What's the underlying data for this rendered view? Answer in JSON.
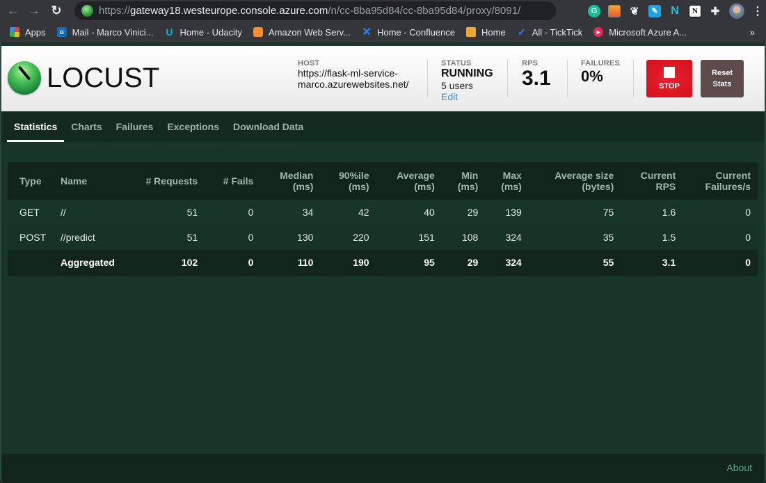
{
  "browser": {
    "url": {
      "scheme": "https://",
      "host": "gateway18.westeurope.console.azure.com",
      "path": "/n/cc-8ba95d84/cc-8ba95d84/proxy/8091/"
    },
    "extensions": [
      "grammarly-icon",
      "image-icon",
      "gnome-icon",
      "pen-icon",
      "nimbus-icon",
      "notion-icon",
      "puzzle-icon"
    ],
    "bookmarks": [
      {
        "label": "Apps",
        "icon": "apps-icon"
      },
      {
        "label": "Mail - Marco Vinici...",
        "icon": "outlook-icon"
      },
      {
        "label": "Home - Udacity",
        "icon": "udacity-icon"
      },
      {
        "label": "Amazon Web Serv...",
        "icon": "aws-icon"
      },
      {
        "label": "Home - Confluence",
        "icon": "confluence-icon"
      },
      {
        "label": "Home",
        "icon": "box-icon"
      },
      {
        "label": "All - TickTick",
        "icon": "ticktick-icon"
      },
      {
        "label": "Microsoft Azure A...",
        "icon": "azure-icon"
      }
    ],
    "bookmarks_more": "»"
  },
  "header": {
    "logo_text": "LOCUST",
    "host_label": "HOST",
    "host_value": "https://flask-ml-service-marco.azurewebsites.net/",
    "status_label": "STATUS",
    "status_value": "RUNNING",
    "users_value": "5 users",
    "edit_label": "Edit",
    "rps_label": "RPS",
    "rps_value": "3.1",
    "failures_label": "FAILURES",
    "failures_value": "0%",
    "stop_label": "STOP",
    "reset_label_1": "Reset",
    "reset_label_2": "Stats"
  },
  "tabs": [
    {
      "label": "Statistics",
      "active": true
    },
    {
      "label": "Charts",
      "active": false
    },
    {
      "label": "Failures",
      "active": false
    },
    {
      "label": "Exceptions",
      "active": false
    },
    {
      "label": "Download Data",
      "active": false
    }
  ],
  "stats_table": {
    "columns": [
      {
        "l1": "Type",
        "l2": ""
      },
      {
        "l1": "Name",
        "l2": ""
      },
      {
        "l1": "# Requests",
        "l2": ""
      },
      {
        "l1": "# Fails",
        "l2": ""
      },
      {
        "l1": "Median",
        "l2": "(ms)"
      },
      {
        "l1": "90%ile",
        "l2": "(ms)"
      },
      {
        "l1": "Average",
        "l2": "(ms)"
      },
      {
        "l1": "Min",
        "l2": "(ms)"
      },
      {
        "l1": "Max",
        "l2": "(ms)"
      },
      {
        "l1": "Average size",
        "l2": "(bytes)"
      },
      {
        "l1": "Current",
        "l2": "RPS"
      },
      {
        "l1": "Current",
        "l2": "Failures/s"
      }
    ],
    "rows": [
      [
        "GET",
        "//",
        "51",
        "0",
        "34",
        "42",
        "40",
        "29",
        "139",
        "75",
        "1.6",
        "0"
      ],
      [
        "POST",
        "//predict",
        "51",
        "0",
        "130",
        "220",
        "151",
        "108",
        "324",
        "35",
        "1.5",
        "0"
      ]
    ],
    "total": [
      "",
      "Aggregated",
      "102",
      "0",
      "110",
      "190",
      "95",
      "29",
      "324",
      "55",
      "3.1",
      "0"
    ]
  },
  "footer": {
    "about_label": "About"
  }
}
